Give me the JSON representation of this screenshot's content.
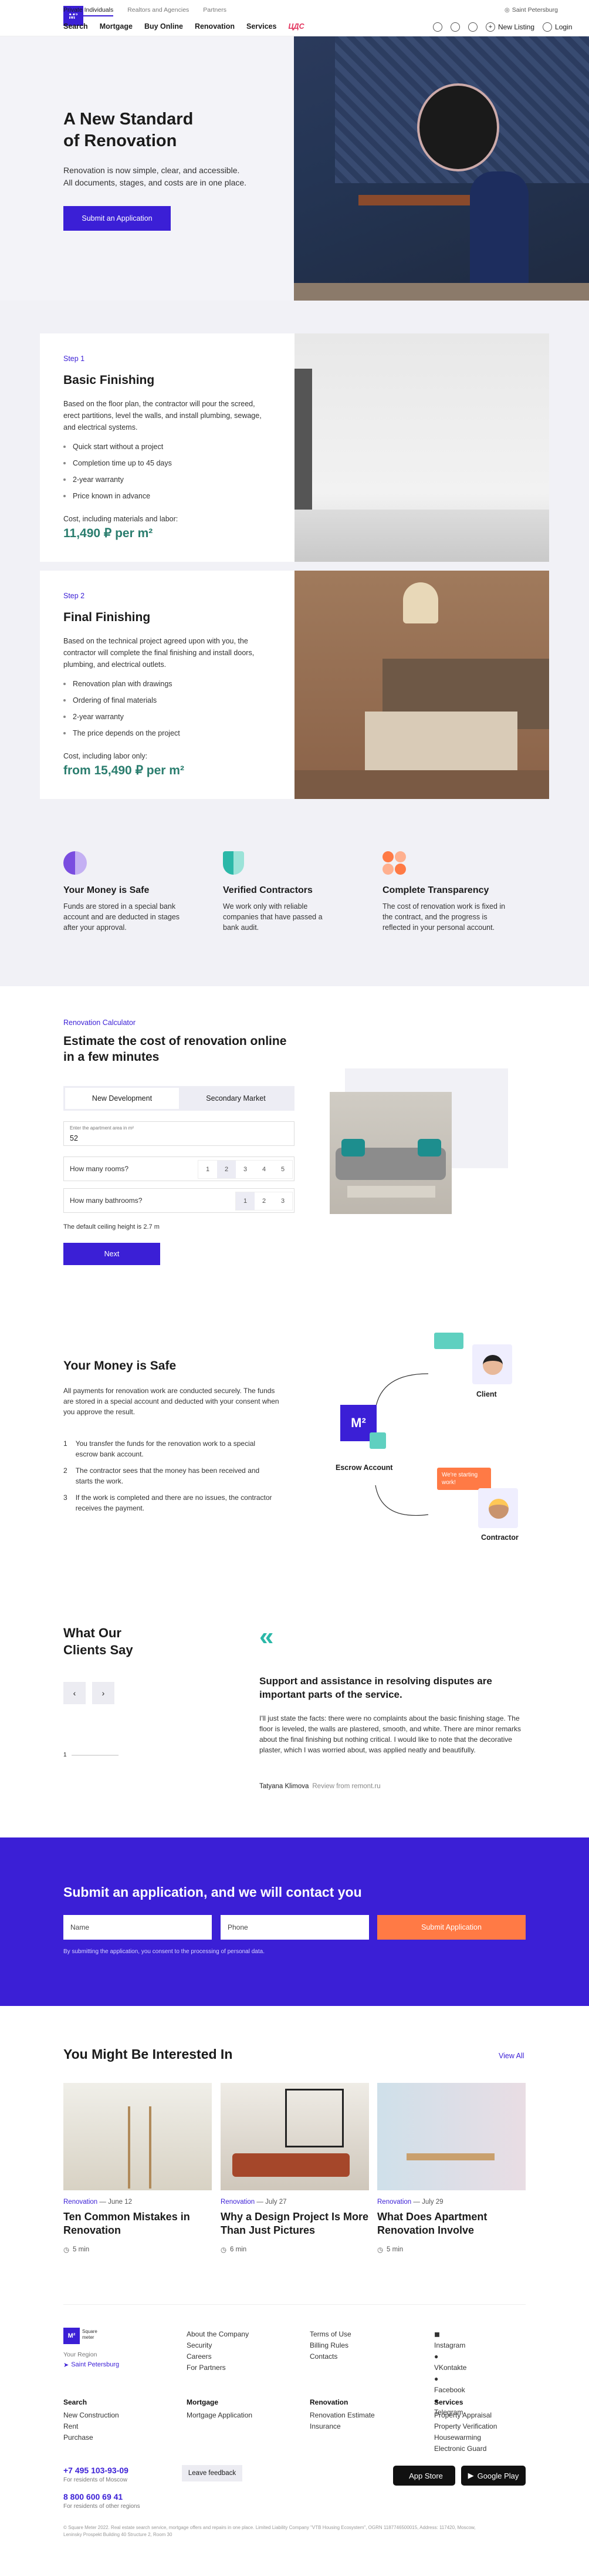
{
  "header": {
    "top_links": [
      "Private Individuals",
      "Realtors and Agencies",
      "Partners"
    ],
    "city": "Saint Petersburg",
    "main_links": [
      "Search",
      "Mortgage",
      "Buy Online",
      "Renovation",
      "Services"
    ],
    "logo_text": "M²",
    "yac": "ЦДС",
    "new_listing": "New Listing",
    "login": "Login"
  },
  "hero": {
    "title_line1": "A New Standard",
    "title_line2": "of Renovation",
    "desc_line1": "Renovation is now simple, clear, and accessible.",
    "desc_line2": "All documents, stages, and costs are in one place.",
    "cta": "Submit an Application"
  },
  "steps": [
    {
      "label": "Step 1",
      "title": "Basic Finishing",
      "desc": "Based on the floor plan, the contractor will pour the screed, erect partitions, level the walls, and install plumbing, sewage, and electrical systems.",
      "bullets": [
        "Quick start without a project",
        "Completion time up to 45 days",
        "2-year warranty",
        "Price known in advance"
      ],
      "cost_label": "Cost, including materials and labor:",
      "price": "11,490 ₽ per m²"
    },
    {
      "label": "Step 2",
      "title": "Final Finishing",
      "desc": "Based on the technical project agreed upon with you, the contractor will complete the final finishing and install doors, plumbing, and electrical outlets.",
      "bullets": [
        "Renovation plan with drawings",
        "Ordering of final materials",
        "2-year warranty",
        "The price depends on the project"
      ],
      "cost_label": "Cost, including labor only:",
      "price": "from 15,490 ₽ per m²"
    }
  ],
  "features": [
    {
      "title": "Your Money is Safe",
      "text": "Funds are stored in a special bank account and are deducted in stages after your approval."
    },
    {
      "title": "Verified Contractors",
      "text": "We work only with reliable companies that have passed a bank audit."
    },
    {
      "title": "Complete Transparency",
      "text": "The cost of renovation work is fixed in the contract, and the progress is reflected in your personal account."
    }
  ],
  "calculator": {
    "label": "Renovation Calculator",
    "title_line1": "Estimate the cost of renovation online",
    "title_line2": "in a few minutes",
    "tabs": [
      "New Development",
      "Secondary Market"
    ],
    "area_label": "Enter the apartment area in m²",
    "area_value": "52",
    "rooms_label": "How many rooms?",
    "rooms_opts": [
      "1",
      "2",
      "3",
      "4",
      "5"
    ],
    "baths_label": "How many bathrooms?",
    "baths_opts": [
      "1",
      "2",
      "3"
    ],
    "ceiling_note": "The default ceiling height is 2.7 m",
    "next": "Next"
  },
  "safe": {
    "title": "Your Money is Safe",
    "desc": "All payments for renovation work are conducted securely. The funds are stored in a special account and deducted with your consent when you approve the result.",
    "items": [
      "You transfer the funds for the renovation work to a special escrow bank account.",
      "The contractor sees that the money has been received and starts the work.",
      "If the work is completed and there are no issues, the contractor receives the payment."
    ],
    "client": "Client",
    "escrow": "Escrow Account",
    "contractor": "Contractor",
    "bubble": "We're starting work!"
  },
  "reviews": {
    "title_line1": "What Our",
    "title_line2": "Clients Say",
    "pager": "1",
    "headline": "Support and assistance in resolving disputes are important parts of the service.",
    "text": "I'll just state the facts: there were no complaints about the basic finishing stage. The floor is leveled, the walls are plastered, smooth, and white. There are minor remarks about the final finishing but nothing critical. I would like to note that the decorative plaster, which I was worried about, was applied neatly and beautifully.",
    "author": "Tatyana Klimova",
    "source": "Review from remont.ru"
  },
  "apply": {
    "title": "Submit an application, and we will contact you",
    "name_ph": "Name",
    "phone_ph": "Phone",
    "submit": "Submit Application",
    "consent": "By submitting the application, you consent to the processing of personal data."
  },
  "articles": {
    "title": "You Might Be Interested In",
    "view_all": "View All",
    "items": [
      {
        "cat": "Renovation",
        "date": "June 12",
        "title": "Ten Common Mistakes in Renovation",
        "read": "5 min"
      },
      {
        "cat": "Renovation",
        "date": "July 27",
        "title": "Why a Design Project Is More Than Just Pictures",
        "read": "6 min"
      },
      {
        "cat": "Renovation",
        "date": "July 29",
        "title": "What Does Apartment Renovation Involve",
        "read": "5 min"
      }
    ]
  },
  "footer": {
    "region_label": "Your Region",
    "region": "Saint Petersburg",
    "col1": [
      "About the Company",
      "Security",
      "Careers",
      "For Partners"
    ],
    "col2": [
      "Terms of Use",
      "Billing Rules",
      "Contacts"
    ],
    "social": [
      "Instagram",
      "VKontakte",
      "Facebook",
      "Telegram"
    ],
    "search_head": "Search",
    "search": [
      "New Construction",
      "Rent",
      "Purchase"
    ],
    "mortgage_head": "Mortgage",
    "mortgage": [
      "Mortgage Application"
    ],
    "renovation_head": "Renovation",
    "renovation": [
      "Renovation Estimate",
      "Insurance"
    ],
    "services_head": "Services",
    "services": [
      "Property Appraisal",
      "Property Verification",
      "Housewarming",
      "Electronic Guard"
    ],
    "phone1": "+7 495 103-93-09",
    "phone1_note": "For residents of Moscow",
    "phone2": "8 800 600 69 41",
    "phone2_note": "For residents of other regions",
    "feedback": "Leave feedback",
    "appstore": "App Store",
    "gplay": "Google Play",
    "legal": "© Square Meter 2022. Real estate search service, mortgage offers and repairs in one place. Limited Liability Company \"VTB Housing Ecosystem\", OGRN 1187746500015, Address: 117420, Moscow, Leninsky Prospekt Building 40 Structure 2, Room 30"
  }
}
